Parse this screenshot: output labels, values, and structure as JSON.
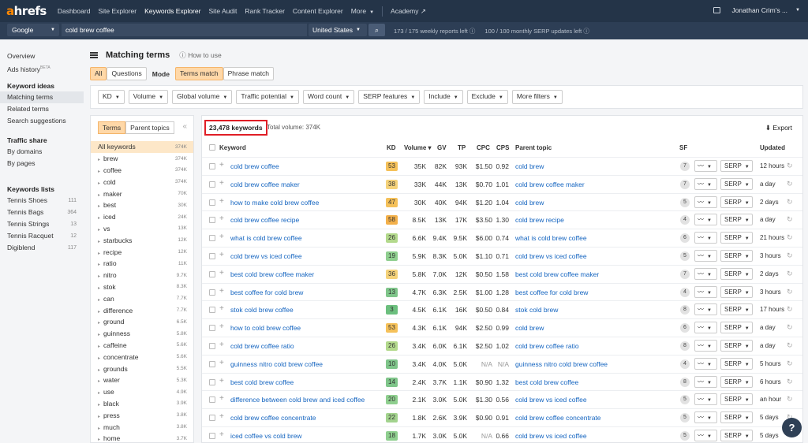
{
  "nav": {
    "logo_a": "a",
    "logo_rest": "hrefs",
    "items": [
      "Dashboard",
      "Site Explorer",
      "Keywords Explorer",
      "Site Audit",
      "Rank Tracker",
      "Content Explorer",
      "More",
      "Academy"
    ],
    "user": "Jonathan Crim's ..."
  },
  "search": {
    "engine": "Google",
    "query": "cold brew coffee",
    "country": "United States",
    "reports_left": "173 / 175 weekly reports left",
    "serp_left": "100 / 100 monthly SERP updates left"
  },
  "sidebar": {
    "top": [
      "Overview",
      "Ads history"
    ],
    "beta": "BETA",
    "keyword_ideas_title": "Keyword ideas",
    "keyword_ideas": [
      "Matching terms",
      "Related terms",
      "Search suggestions"
    ],
    "traffic_share_title": "Traffic share",
    "traffic_share": [
      "By domains",
      "By pages"
    ],
    "lists_title": "Keywords lists",
    "lists": [
      {
        "name": "Tennis Shoes",
        "count": "111"
      },
      {
        "name": "Tennis Bags",
        "count": "364"
      },
      {
        "name": "Tennis Strings",
        "count": "13"
      },
      {
        "name": "Tennis Racquet",
        "count": "12"
      },
      {
        "name": "Digiblend",
        "count": "117"
      }
    ]
  },
  "page": {
    "title": "Matching terms",
    "how_to": "How to use",
    "mode_all": "All",
    "mode_questions": "Questions",
    "mode_label": "Mode",
    "mode_terms": "Terms match",
    "mode_phrase": "Phrase match"
  },
  "filters": [
    "KD",
    "Volume",
    "Global volume",
    "Traffic potential",
    "Word count",
    "SERP features",
    "Include",
    "Exclude",
    "More filters"
  ],
  "left_panel": {
    "tab_terms": "Terms",
    "tab_parents": "Parent topics",
    "rows": [
      {
        "term": "All keywords",
        "count": "374K"
      },
      {
        "term": "brew",
        "count": "374K"
      },
      {
        "term": "coffee",
        "count": "374K"
      },
      {
        "term": "cold",
        "count": "374K"
      },
      {
        "term": "maker",
        "count": "70K"
      },
      {
        "term": "best",
        "count": "30K"
      },
      {
        "term": "iced",
        "count": "24K"
      },
      {
        "term": "vs",
        "count": "13K"
      },
      {
        "term": "starbucks",
        "count": "12K"
      },
      {
        "term": "recipe",
        "count": "12K"
      },
      {
        "term": "ratio",
        "count": "11K"
      },
      {
        "term": "nitro",
        "count": "9.7K"
      },
      {
        "term": "stok",
        "count": "8.3K"
      },
      {
        "term": "can",
        "count": "7.7K"
      },
      {
        "term": "difference",
        "count": "7.7K"
      },
      {
        "term": "ground",
        "count": "6.5K"
      },
      {
        "term": "guinness",
        "count": "5.8K"
      },
      {
        "term": "caffeine",
        "count": "5.6K"
      },
      {
        "term": "concentrate",
        "count": "5.6K"
      },
      {
        "term": "grounds",
        "count": "5.5K"
      },
      {
        "term": "water",
        "count": "5.3K"
      },
      {
        "term": "use",
        "count": "4.9K"
      },
      {
        "term": "black",
        "count": "3.9K"
      },
      {
        "term": "press",
        "count": "3.8K"
      },
      {
        "term": "much",
        "count": "3.8K"
      },
      {
        "term": "home",
        "count": "3.7K"
      }
    ]
  },
  "table": {
    "count_label": "23,478 keywords",
    "total_volume": "Total volume: 374K",
    "export": "Export",
    "headers": {
      "keyword": "Keyword",
      "kd": "KD",
      "volume": "Volume",
      "gv": "GV",
      "tp": "TP",
      "cpc": "CPC",
      "cps": "CPS",
      "parent": "Parent topic",
      "sf": "SF",
      "updated": "Updated"
    },
    "serp_label": "SERP",
    "rows": [
      {
        "kw": "cold brew coffee",
        "kd": "53",
        "kd_color": "#f5c15a",
        "vol": "35K",
        "gv": "82K",
        "tp": "93K",
        "cpc": "$1.50",
        "cps": "0.92",
        "parent": "cold brew",
        "sf": "7",
        "upd": "12 hours"
      },
      {
        "kw": "cold brew coffee maker",
        "kd": "38",
        "kd_color": "#f5d27a",
        "vol": "33K",
        "gv": "44K",
        "tp": "13K",
        "cpc": "$0.70",
        "cps": "1.01",
        "parent": "cold brew coffee maker",
        "sf": "7",
        "upd": "a day"
      },
      {
        "kw": "how to make cold brew coffee",
        "kd": "47",
        "kd_color": "#f5c15a",
        "vol": "30K",
        "gv": "40K",
        "tp": "94K",
        "cpc": "$1.20",
        "cps": "1.04",
        "parent": "cold brew",
        "sf": "5",
        "upd": "2 days"
      },
      {
        "kw": "cold brew coffee recipe",
        "kd": "58",
        "kd_color": "#f3b04a",
        "vol": "8.5K",
        "gv": "13K",
        "tp": "17K",
        "cpc": "$3.50",
        "cps": "1.30",
        "parent": "cold brew recipe",
        "sf": "4",
        "upd": "a day"
      },
      {
        "kw": "what is cold brew coffee",
        "kd": "26",
        "kd_color": "#b3d98c",
        "vol": "6.6K",
        "gv": "9.4K",
        "tp": "9.5K",
        "cpc": "$6.00",
        "cps": "0.74",
        "parent": "what is cold brew coffee",
        "sf": "6",
        "upd": "21 hours"
      },
      {
        "kw": "cold brew vs iced coffee",
        "kd": "19",
        "kd_color": "#8fcf8f",
        "vol": "5.9K",
        "gv": "8.3K",
        "tp": "5.0K",
        "cpc": "$1.10",
        "cps": "0.71",
        "parent": "cold brew vs iced coffee",
        "sf": "5",
        "upd": "3 hours"
      },
      {
        "kw": "best cold brew coffee maker",
        "kd": "36",
        "kd_color": "#f5d27a",
        "vol": "5.8K",
        "gv": "7.0K",
        "tp": "12K",
        "cpc": "$0.50",
        "cps": "1.58",
        "parent": "best cold brew coffee maker",
        "sf": "7",
        "upd": "2 days"
      },
      {
        "kw": "best coffee for cold brew",
        "kd": "13",
        "kd_color": "#7fc58a",
        "vol": "4.7K",
        "gv": "6.3K",
        "tp": "2.5K",
        "cpc": "$1.00",
        "cps": "1.28",
        "parent": "best coffee for cold brew",
        "sf": "4",
        "upd": "3 hours"
      },
      {
        "kw": "stok cold brew coffee",
        "kd": "3",
        "kd_color": "#6cbf7e",
        "vol": "4.5K",
        "gv": "6.1K",
        "tp": "16K",
        "cpc": "$0.50",
        "cps": "0.84",
        "parent": "stok cold brew",
        "sf": "8",
        "upd": "17 hours"
      },
      {
        "kw": "how to cold brew coffee",
        "kd": "53",
        "kd_color": "#f5c15a",
        "vol": "4.3K",
        "gv": "6.1K",
        "tp": "94K",
        "cpc": "$2.50",
        "cps": "0.99",
        "parent": "cold brew",
        "sf": "6",
        "upd": "a day"
      },
      {
        "kw": "cold brew coffee ratio",
        "kd": "26",
        "kd_color": "#b3d98c",
        "vol": "3.4K",
        "gv": "6.0K",
        "tp": "6.1K",
        "cpc": "$2.50",
        "cps": "1.02",
        "parent": "cold brew coffee ratio",
        "sf": "8",
        "upd": "a day"
      },
      {
        "kw": "guinness nitro cold brew coffee",
        "kd": "10",
        "kd_color": "#7fc58a",
        "vol": "3.4K",
        "gv": "4.0K",
        "tp": "5.0K",
        "cpc": "N/A",
        "cps": "N/A",
        "parent": "guinness nitro cold brew coffee",
        "sf": "4",
        "upd": "5 hours"
      },
      {
        "kw": "best cold brew coffee",
        "kd": "14",
        "kd_color": "#7fc58a",
        "vol": "2.4K",
        "gv": "3.7K",
        "tp": "1.1K",
        "cpc": "$0.90",
        "cps": "1.32",
        "parent": "best cold brew coffee",
        "sf": "8",
        "upd": "6 hours"
      },
      {
        "kw": "difference between cold brew and iced coffee",
        "kd": "20",
        "kd_color": "#8fcf8f",
        "vol": "2.1K",
        "gv": "3.0K",
        "tp": "5.0K",
        "cpc": "$1.30",
        "cps": "0.56",
        "parent": "cold brew vs iced coffee",
        "sf": "5",
        "upd": "an hour"
      },
      {
        "kw": "cold brew coffee concentrate",
        "kd": "22",
        "kd_color": "#a3d38e",
        "vol": "1.8K",
        "gv": "2.6K",
        "tp": "3.9K",
        "cpc": "$0.90",
        "cps": "0.91",
        "parent": "cold brew coffee concentrate",
        "sf": "5",
        "upd": "5 days"
      },
      {
        "kw": "iced coffee vs cold brew",
        "kd": "18",
        "kd_color": "#8fcf8f",
        "vol": "1.7K",
        "gv": "3.0K",
        "tp": "5.0K",
        "cpc": "N/A",
        "cps": "0.66",
        "parent": "cold brew vs iced coffee",
        "sf": "5",
        "upd": "5 days"
      }
    ]
  },
  "help": "?"
}
